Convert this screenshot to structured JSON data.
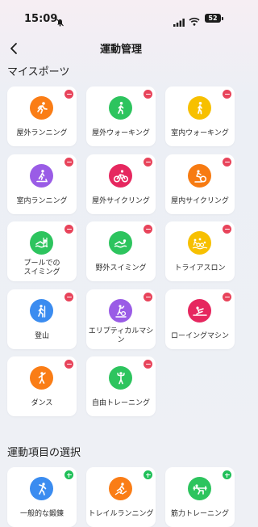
{
  "status_bar": {
    "time": "15:09",
    "battery": "52"
  },
  "header": {
    "title": "運動管理"
  },
  "my_sports": {
    "title": "マイスポーツ",
    "items": [
      {
        "label": "屋外ランニング",
        "icon": "outdoor-running-icon",
        "color": "#fa7d16"
      },
      {
        "label": "屋外ウォーキング",
        "icon": "outdoor-walking-icon",
        "color": "#2dc45e"
      },
      {
        "label": "室内ウォーキング",
        "icon": "indoor-walking-icon",
        "color": "#f7c000"
      },
      {
        "label": "室内ランニング",
        "icon": "indoor-running-icon",
        "color": "#9a5ce6"
      },
      {
        "label": "屋外サイクリング",
        "icon": "outdoor-cycling-icon",
        "color": "#e6275f"
      },
      {
        "label": "屋内サイクリング",
        "icon": "indoor-cycling-icon",
        "color": "#f77b12"
      },
      {
        "label": "プールでの\nスイミング",
        "icon": "pool-swimming-icon",
        "color": "#2dc45e"
      },
      {
        "label": "野外スイミング",
        "icon": "open-water-swimming-icon",
        "color": "#2dc45e"
      },
      {
        "label": "トライアスロン",
        "icon": "triathlon-icon",
        "color": "#f7c000"
      },
      {
        "label": "登山",
        "icon": "climbing-icon",
        "color": "#3b8cf0"
      },
      {
        "label": "エリプティカルマシン",
        "icon": "elliptical-icon",
        "color": "#9a5ce6"
      },
      {
        "label": "ローイングマシン",
        "icon": "rowing-machine-icon",
        "color": "#e6275f"
      },
      {
        "label": "ダンス",
        "icon": "dance-icon",
        "color": "#fa7d16"
      },
      {
        "label": "自由トレーニング",
        "icon": "free-training-icon",
        "color": "#2dc45e"
      }
    ]
  },
  "select_sports": {
    "title": "運動項目の選択",
    "items": [
      {
        "label": "一般的な鍛錬",
        "icon": "general-exercise-icon",
        "color": "#3b8cf0"
      },
      {
        "label": "トレイルランニング",
        "icon": "trail-running-icon",
        "color": "#fa7d16"
      },
      {
        "label": "筋力トレーニング",
        "icon": "strength-training-icon",
        "color": "#2dc45e"
      }
    ]
  }
}
